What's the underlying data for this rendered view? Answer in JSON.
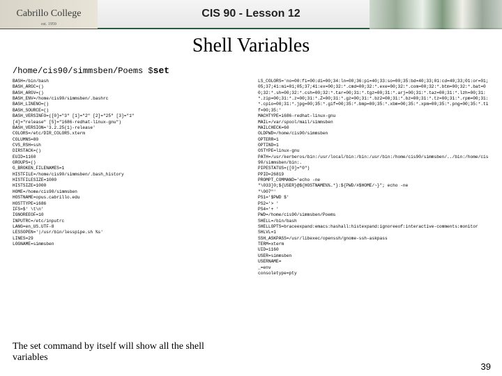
{
  "header": {
    "logo_text": "Cabrillo College",
    "logo_est": "est. 1959",
    "course_title": "CIS 90 - Lesson 12"
  },
  "main_title": "Shell Variables",
  "prompt": {
    "path": "/home/cis90/simmsben/Poems $",
    "command": "set"
  },
  "left_output": "BASH=/bin/bash\nBASH_ARGC=()\nBASH_ARGV=()\nBASH_ENV=/home/cis90/simmsben/.bashrc\nBASH_LINENO=()\nBASH_SOURCE=()\nBASH_VERSINFO=([0]=\"3\" [1]=\"2\" [2]=\"25\" [3]=\"1\"\n[4]=\"release\" [5]=\"i686-redhat-linux-gnu\")\nBASH_VERSION='3.2.25(1)-release'\nCOLORS=/etc/DIR_COLORS.xterm\nCOLUMNS=80\nCVS_RSH=ssh\nDIRSTACK=()\nEUID=1160\nGROUPS=()\nG_BROKEN_FILENAMES=1\nHISTFILE=/home/cis90/simmsben/.bash_history\nHISTFILESIZE=1000\nHISTSIZE=1000\nHOME=/home/cis90/simmsben\nHOSTNAME=opus.cabrillo.edu\nHOSTTYPE=i686\nIFS=$' \\t\\n'\nIGNOREEOF=10\nINPUTRC=/etc/inputrc\nLANG=en_US.UTF-8\nLESSOPEN='|/usr/bin/lesspipe.sh %s'\nLINES=29\nLOGNAME=simmsben",
  "right_output": "LS_COLORS='no=00:fi=00:di=00;34:ln=00;36:pi=40;33:so=00;35:bd=40;33;01:cd=40;33;01:or=01;05;37;41:mi=01;05;37;41:ex=00;32:*.cmd=00;32:*.exe=00;32:*.com=00;32:*.btm=00;32:*.bat=00;32:*.sh=00;32:*.csh=00;32:*.tar=00;31:*.tgz=00;31:*.arj=00;31:*.taz=00;31:*.lzh=00;31:*.zip=00;31:*.z=00;31:*.Z=00;31:*.gz=00;31:*.bz2=00;31:*.bz=00;31:*.tz=00;31:*.rpm=00;31:*.cpio=00;31:*.jpg=00;35:*.gif=00;35:*.bmp=00;35:*.xbm=00;35:*.xpm=00;35:*.png=00;35:*.tif=00;35:'\nMACHTYPE=i686-redhat-linux-gnu\nMAIL=/var/spool/mail/simmsben\nMAILCHECK=60\nOLDPWD=/home/cis90/simmsben\nOPTERR=1\nOPTIND=1\nOSTYPE=linux-gnu\nPATH=/usr/kerberos/bin:/usr/local/bin:/bin:/usr/bin:/home/cis90/simmsben/../bin:/home/cis90/simmsben/bin:.\nPIPESTATUS=([0]=\"0\")\nPPID=26819\nPROMPT_COMMAND='echo -ne\n\"\\033]0;${USER}@${HOSTNAME%%.*}:${PWD/#$HOME/~}\"; echo -ne\n\"\\007\"'\nPS1='$PWD $'\nPS2='> '\nPS4='+ '\nPWD=/home/cis90/simmsben/Poems\nSHELL=/bin/bash\nSHELLOPTS=braceexpand:emacs:hashall:histexpand:ignoreeof:interactive-comments:monitor\nSHLVL=1\nSSH_ASKPASS=/usr/libexec/openssh/gnome-ssh-askpass\nTERM=xterm\nUID=1160\nUSER=simmsben\nUSERNAME=\n_=env\nconsoletype=pty",
  "caption": "The set command by itself will show all the shell variables",
  "pagenum": "39"
}
